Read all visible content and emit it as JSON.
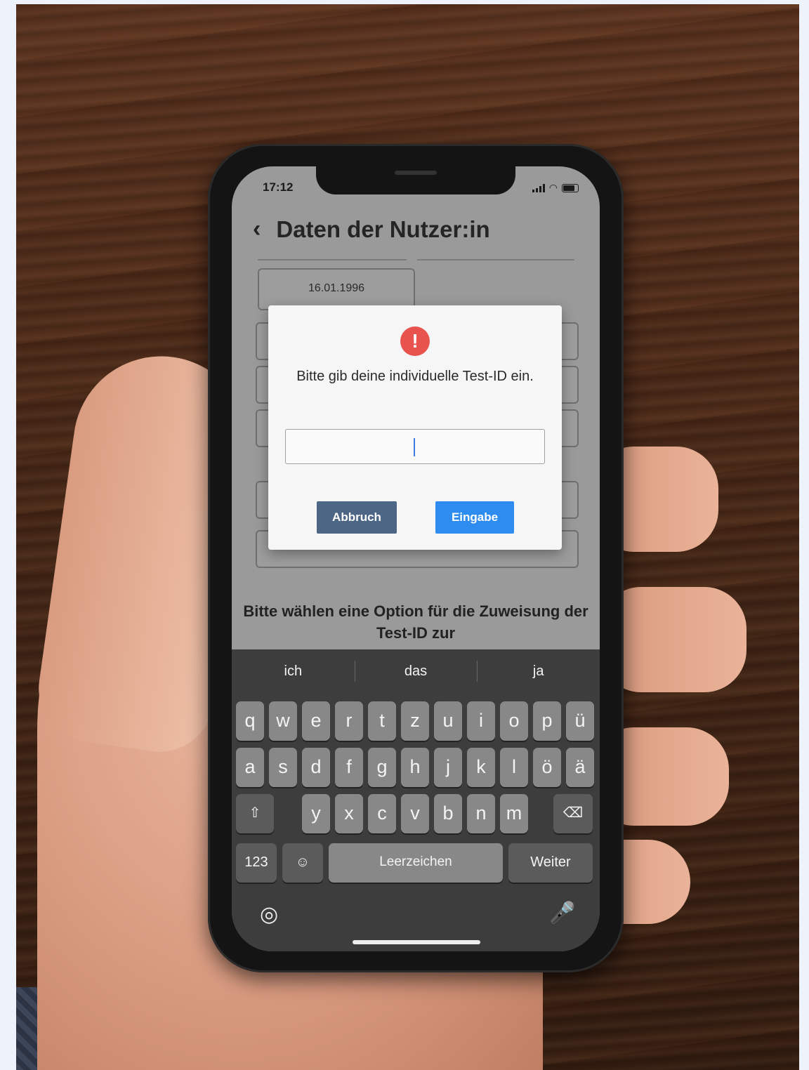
{
  "status_bar": {
    "time": "17:12"
  },
  "header": {
    "title": "Daten der Nutzer:in"
  },
  "form": {
    "birth_date": "16.01.1996"
  },
  "assignment": {
    "prompt": "Bitte wählen eine Option für die Zuweisung der Test-ID zur"
  },
  "dialog": {
    "message": "Bitte gib deine individuelle Test-ID ein.",
    "input_value": "",
    "cancel_label": "Abbruch",
    "confirm_label": "Eingabe",
    "alert_color": "#e8534d",
    "confirm_color": "#2e8bef",
    "cancel_color": "#4e6685"
  },
  "keyboard": {
    "suggestions": [
      "ich",
      "das",
      "ja"
    ],
    "row1": [
      "q",
      "w",
      "e",
      "r",
      "t",
      "z",
      "u",
      "i",
      "o",
      "p",
      "ü"
    ],
    "row2": [
      "a",
      "s",
      "d",
      "f",
      "g",
      "h",
      "j",
      "k",
      "l",
      "ö",
      "ä"
    ],
    "row3": [
      "y",
      "x",
      "c",
      "v",
      "b",
      "n",
      "m"
    ],
    "numbers_label": "123",
    "space_label": "Leerzeichen",
    "return_label": "Weiter"
  }
}
